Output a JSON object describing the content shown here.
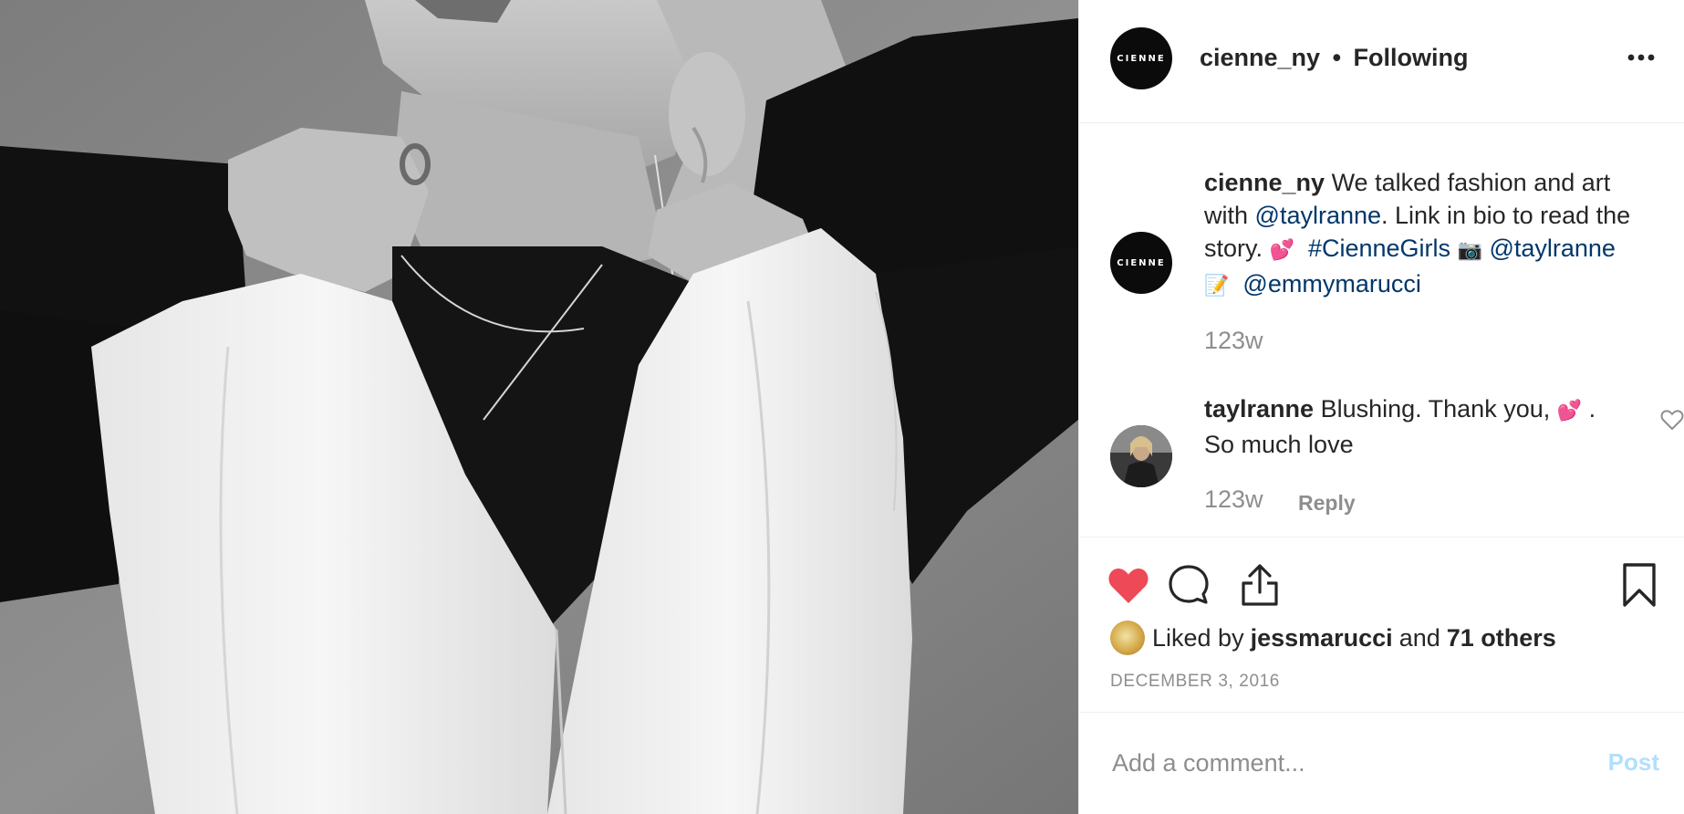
{
  "post": {
    "account": "cienne_ny",
    "separator": "•",
    "follow_status": "Following",
    "avatar_label": "CIENNE"
  },
  "caption": {
    "user": "cienne_ny",
    "text_1": " We talked fashion and art with ",
    "mention_1": "@taylranne",
    "text_2": ". Link in bio to read the story. ",
    "emoji_1": "💕",
    "hashtag": "#CienneGirls",
    "emoji_2": "📷",
    "mention_2": "@taylranne",
    "emoji_3": "📝",
    "mention_3": "@emmymarucci",
    "time": "123w"
  },
  "reply": {
    "user": "taylranne",
    "text_1": " Blushing. Thank you, ",
    "emoji": "💕",
    "text_2": " . So much love",
    "time": "123w",
    "reply_label": "Reply"
  },
  "likes": {
    "prefix": "Liked by",
    "user": "jessmarucci",
    "conjunction": "and",
    "others": "71 others",
    "liked": true,
    "like_color": "#ed4956"
  },
  "date": "DECEMBER 3, 2016",
  "comment_box": {
    "placeholder": "Add a comment...",
    "post_label": "Post",
    "post_color": "#b2dffc"
  },
  "icons": {
    "more": "more-options-icon",
    "like": "heart-filled-icon",
    "comment": "comment-bubble-icon",
    "share": "share-icon",
    "save": "bookmark-icon",
    "reply_like": "heart-outline-icon"
  }
}
